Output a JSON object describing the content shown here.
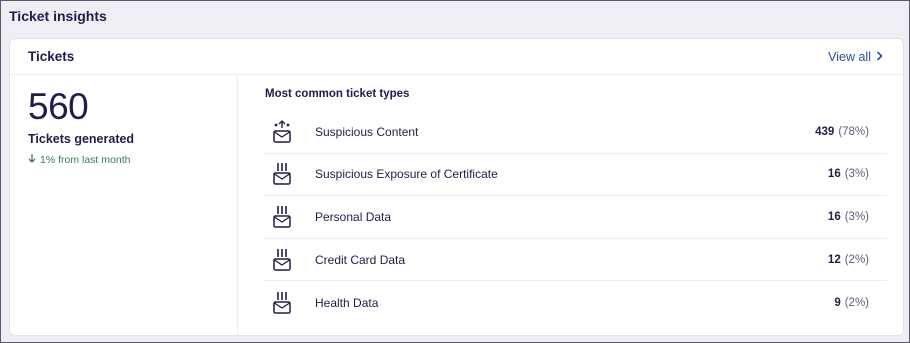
{
  "section": {
    "title": "Ticket insights"
  },
  "card": {
    "title": "Tickets",
    "view_all_label": "View all"
  },
  "summary": {
    "count": "560",
    "label": "Tickets generated",
    "trend_text": "1% from last month",
    "trend_direction": "down",
    "trend_color": "#3f7a4e"
  },
  "types": {
    "title": "Most common ticket types",
    "items": [
      {
        "name": "Suspicious Content",
        "count": "439",
        "pct": "(78%)",
        "icon": "mail-alert-icon"
      },
      {
        "name": "Suspicious Exposure of Certificate",
        "count": "16",
        "pct": "(3%)",
        "icon": "mail-bars-icon"
      },
      {
        "name": "Personal Data",
        "count": "16",
        "pct": "(3%)",
        "icon": "mail-bars-icon"
      },
      {
        "name": "Credit Card Data",
        "count": "12",
        "pct": "(2%)",
        "icon": "mail-bars-icon"
      },
      {
        "name": "Health Data",
        "count": "9",
        "pct": "(2%)",
        "icon": "mail-bars-icon"
      }
    ]
  },
  "colors": {
    "background": "#eeeef4",
    "text_primary": "#1f1d4a",
    "link": "#2b4f96"
  }
}
